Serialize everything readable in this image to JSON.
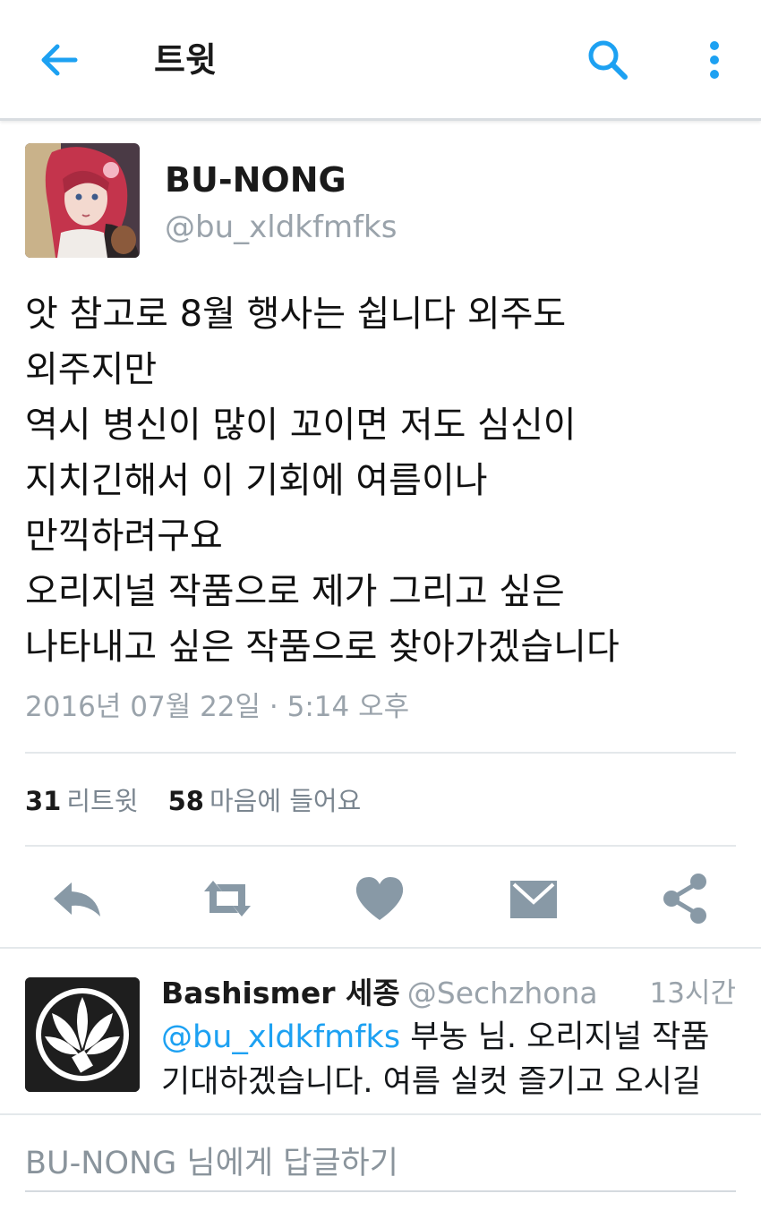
{
  "header": {
    "title": "트윗",
    "back_icon": "arrow-left-icon",
    "search_icon": "search-icon",
    "more_icon": "more-vertical-icon",
    "accent": "#1da1f2"
  },
  "tweet": {
    "name": "BU-NONG",
    "handle": "@bu_xldkfmfks",
    "lines": [
      "앗 참고로 8월 행사는 쉽니다 외주도",
      "외주지만",
      "역시 병신이 많이 꼬이면 저도 심신이",
      "지치긴해서 이 기회에 여름이나",
      "만끽하려구요",
      "오리지널 작품으로 제가 그리고 싶은",
      "나타내고 싶은 작품으로 찾아가겠습니다"
    ],
    "timestamp": "2016년 07월 22일 · 5:14 오후",
    "retweets": "31",
    "retweets_label": "리트윗",
    "likes": "58",
    "likes_label": "마음에 들어요"
  },
  "actions": [
    {
      "name": "reply-icon"
    },
    {
      "name": "retweet-icon"
    },
    {
      "name": "heart-icon"
    },
    {
      "name": "message-icon"
    },
    {
      "name": "share-icon"
    }
  ],
  "reply": {
    "name": "Bashismer 세종",
    "handle": "@Sechzhona",
    "time": "13시간",
    "mention": "@bu_xldkfmfks",
    "line1_rest": " 부농 님. 오리지널 작품",
    "line2": "기대하겠습니다. 여름 실컷 즐기고 오시길"
  },
  "composer": {
    "placeholder": "BU-NONG 님에게 답글하기"
  },
  "colors": {
    "icon_gray": "#8899a6",
    "muted_text": "#9aa3ab",
    "divider": "#e4e8eb"
  }
}
